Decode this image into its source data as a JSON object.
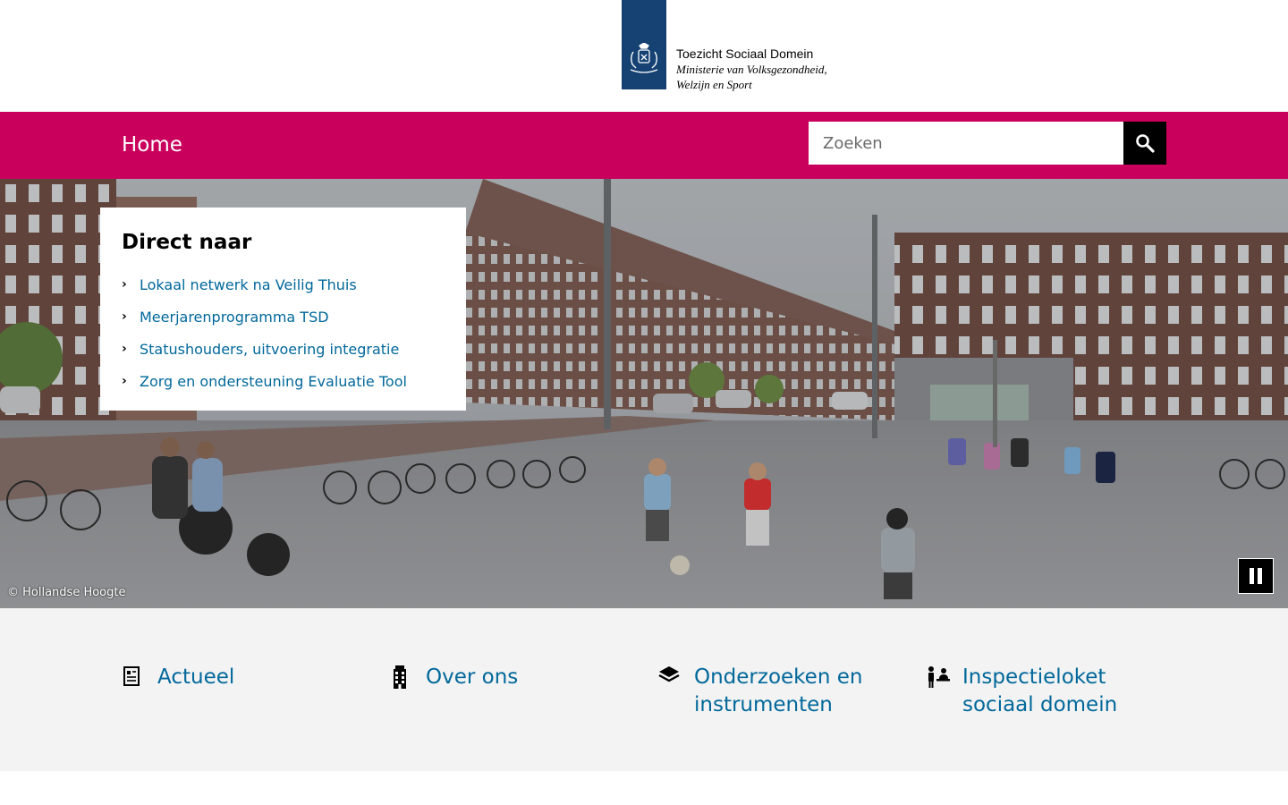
{
  "header": {
    "org_name": "Toezicht Sociaal Domein",
    "ministry_line1": "Ministerie van Volksgezondheid,",
    "ministry_line2": "Welzijn en Sport"
  },
  "nav": {
    "home_label": "Home",
    "search_placeholder": "Zoeken"
  },
  "hero": {
    "direct_title": "Direct naar",
    "links": [
      "Lokaal netwerk na Veilig Thuis",
      "Meerjarenprogramma TSD",
      "Statushouders, uitvoering integratie",
      "Zorg en ondersteuning Evaluatie Tool"
    ],
    "credit": "© Hollandse Hoogte"
  },
  "tiles": [
    {
      "icon": "newspaper-icon",
      "label_line1": "Actueel",
      "label_line2": ""
    },
    {
      "icon": "building-icon",
      "label_line1": "Over ons",
      "label_line2": ""
    },
    {
      "icon": "layers-icon",
      "label_line1": "Onderzoeken en",
      "label_line2": "instrumenten"
    },
    {
      "icon": "service-desk-icon",
      "label_line1": "Inspectieloket",
      "label_line2": "sociaal domein"
    }
  ],
  "colors": {
    "brand_blue": "#154273",
    "nav_magenta": "#ca005d",
    "link_blue": "#01689b",
    "tile_bg": "#f3f3f3"
  }
}
